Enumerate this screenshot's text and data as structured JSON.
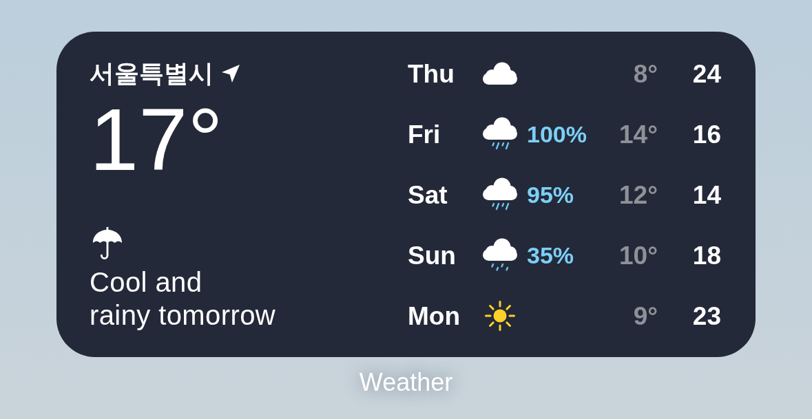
{
  "widget": {
    "location": {
      "name": "서울특별시",
      "current_location": true
    },
    "temperature": "17°",
    "summary": "Cool and\nrainy tomorrow",
    "forecast": [
      {
        "day": "Thu",
        "kind": "cloudy",
        "low": "8°",
        "high": "24"
      },
      {
        "day": "Fri",
        "kind": "rain",
        "precipitation": "100%",
        "low": "14°",
        "high": "16"
      },
      {
        "day": "Sat",
        "kind": "rain",
        "precipitation": "95%",
        "low": "12°",
        "high": "14"
      },
      {
        "day": "Sun",
        "kind": "drizzle",
        "precipitation": "35%",
        "low": "10°",
        "high": "18"
      },
      {
        "day": "Mon",
        "kind": "sunny",
        "low": "9°",
        "high": "23"
      }
    ]
  },
  "app_label": "Weather"
}
